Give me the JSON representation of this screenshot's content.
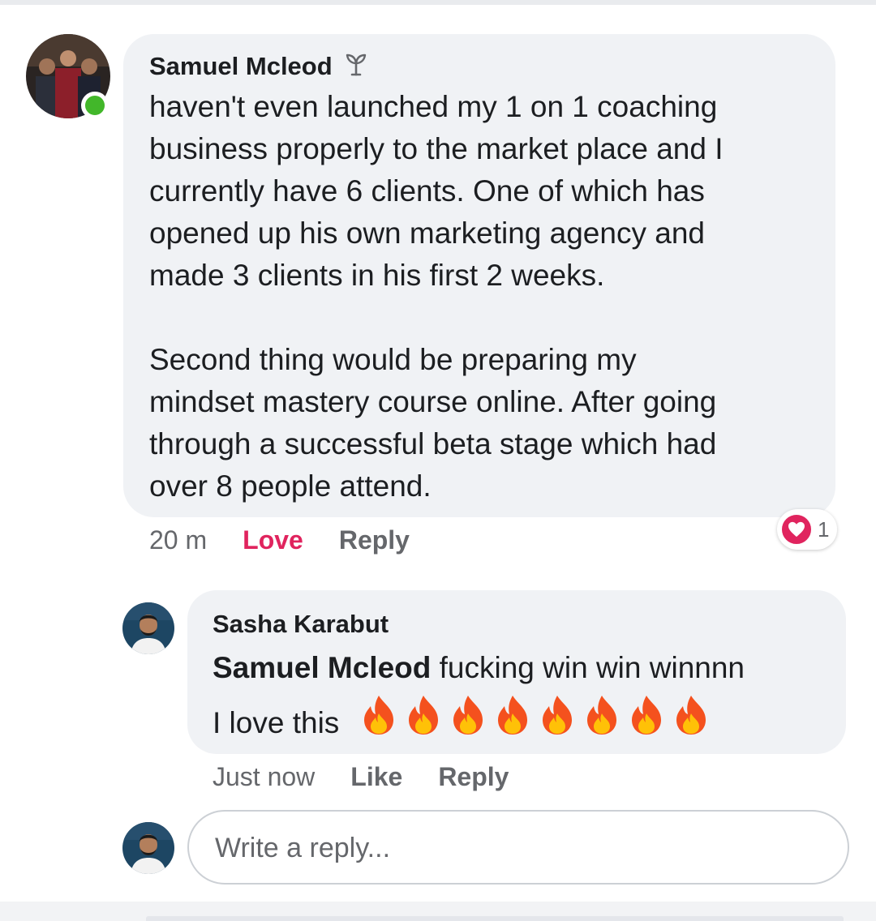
{
  "comment": {
    "author": "Samuel Mcleod",
    "author_badge_icon": "sprout-badge-icon",
    "online": true,
    "paragraphs": [
      [
        "haven't even launched my 1 on 1 coaching",
        "business properly to the market place and I",
        "currently have 6 clients. One of which has",
        "opened up his own marketing agency and",
        "made 3 clients in his first 2 weeks."
      ],
      [
        "Second thing would be preparing my",
        "mindset mastery course online. After going",
        "through a successful beta stage which had",
        "over 8 people attend."
      ]
    ],
    "timestamp": "20 m",
    "reaction_label": "Love",
    "reply_label": "Reply",
    "reaction_count": "1",
    "reaction_color": "#e0245e"
  },
  "reply": {
    "author": "Sasha Karabut",
    "mention": "Samuel Mcleod",
    "text_after_mention": " fucking win win winnnn",
    "line2": "I love this ",
    "emoji_count": 8,
    "timestamp": "Just now",
    "like_label": "Like",
    "reply_label": "Reply"
  },
  "composer": {
    "placeholder": "Write a reply..."
  }
}
